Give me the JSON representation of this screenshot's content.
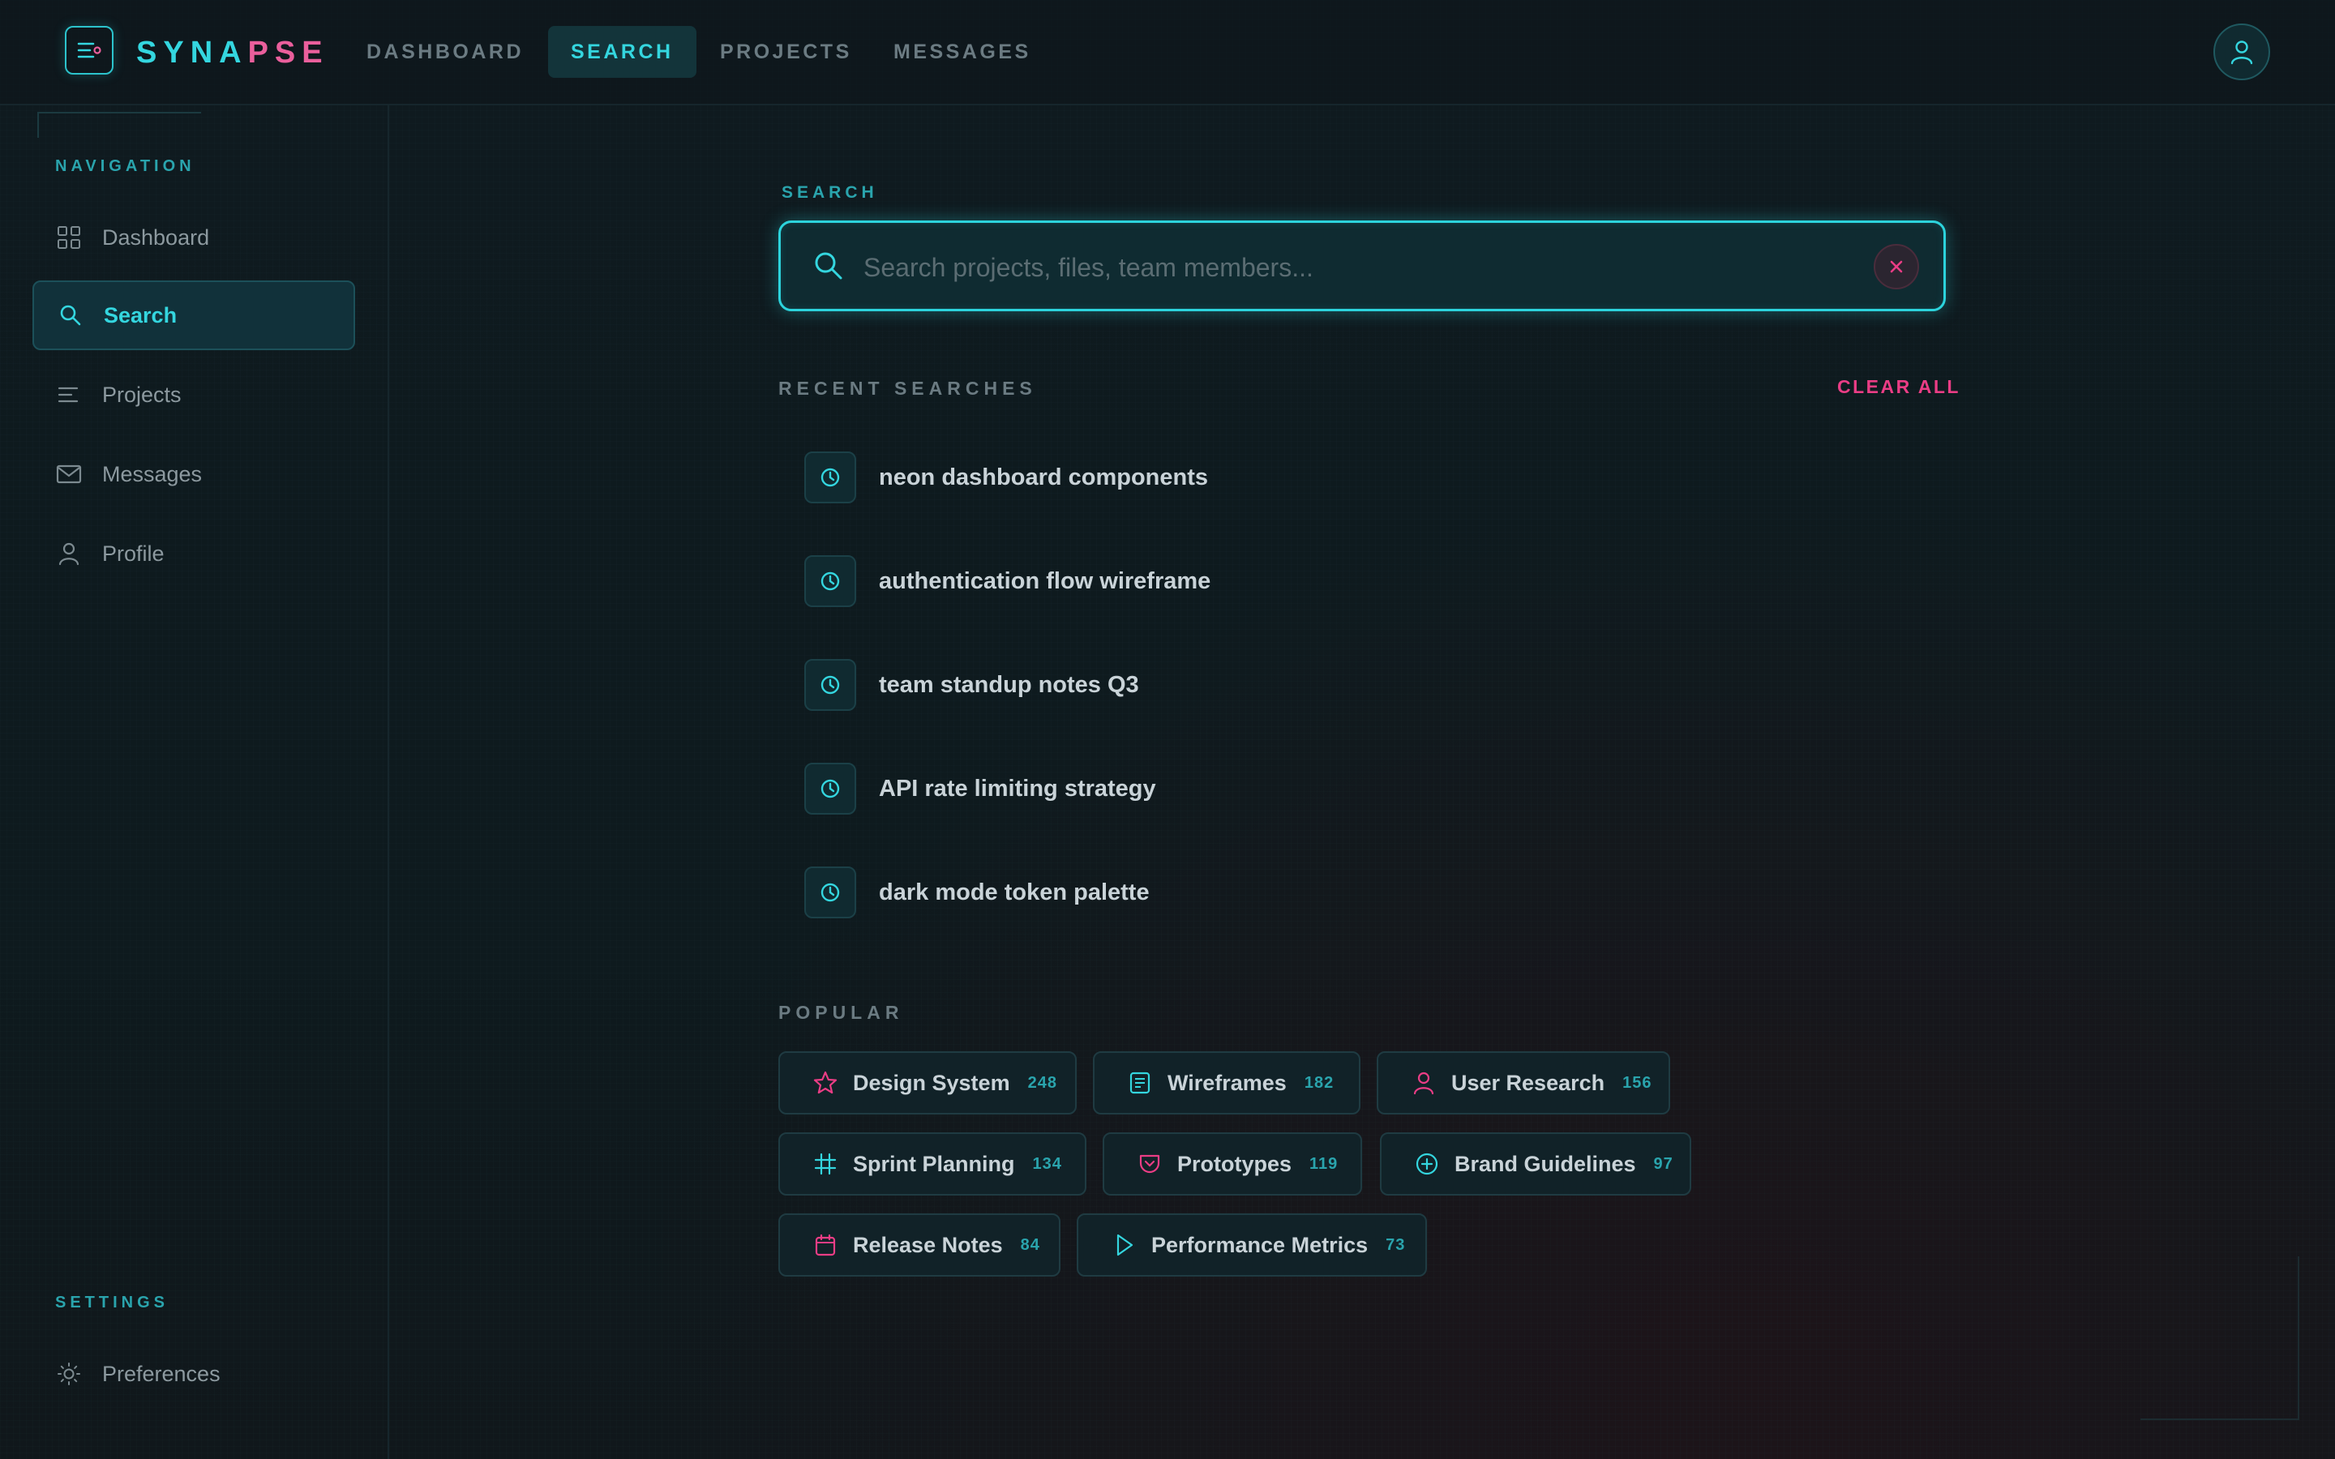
{
  "brand": {
    "part1": "SYNA",
    "part2": "PSE"
  },
  "topnav": {
    "tabs": [
      {
        "label": "DASHBOARD"
      },
      {
        "label": "SEARCH"
      },
      {
        "label": "PROJECTS"
      },
      {
        "label": "MESSAGES"
      }
    ],
    "active_tab": "SEARCH"
  },
  "sidebar": {
    "nav_label": "NAVIGATION",
    "items": [
      {
        "label": "Dashboard",
        "icon": "grid-icon"
      },
      {
        "label": "Search",
        "icon": "search-icon"
      },
      {
        "label": "Projects",
        "icon": "lines-icon"
      },
      {
        "label": "Messages",
        "icon": "mail-icon"
      },
      {
        "label": "Profile",
        "icon": "user-icon"
      }
    ],
    "active_item": "Search",
    "settings_label": "SETTINGS",
    "settings_items": [
      {
        "label": "Preferences",
        "icon": "sun-icon"
      }
    ]
  },
  "search": {
    "label": "SEARCH",
    "placeholder": "Search projects, files, team members...",
    "value": ""
  },
  "recent": {
    "label": "RECENT SEARCHES",
    "clear_label": "CLEAR ALL",
    "items": [
      "neon dashboard components",
      "authentication flow wireframe",
      "team standup notes Q3",
      "API rate limiting strategy",
      "dark mode token palette"
    ]
  },
  "popular": {
    "label": "POPULAR",
    "tags": [
      {
        "label": "Design System",
        "count": "248",
        "icon": "star-icon",
        "color": "#ea3d85"
      },
      {
        "label": "Wireframes",
        "count": "182",
        "icon": "document-icon",
        "color": "#34d6df"
      },
      {
        "label": "User Research",
        "count": "156",
        "icon": "user-icon",
        "color": "#ea3d85"
      },
      {
        "label": "Sprint Planning",
        "count": "134",
        "icon": "hash-icon",
        "color": "#34d6df"
      },
      {
        "label": "Prototypes",
        "count": "119",
        "icon": "pocket-icon",
        "color": "#ea3d85"
      },
      {
        "label": "Brand Guidelines",
        "count": "97",
        "icon": "plus-circle-icon",
        "color": "#34d6df"
      },
      {
        "label": "Release Notes",
        "count": "84",
        "icon": "calendar-icon",
        "color": "#ea3d85"
      },
      {
        "label": "Performance Metrics",
        "count": "73",
        "icon": "play-icon",
        "color": "#34d6df"
      }
    ]
  },
  "colors": {
    "accent_cyan": "#34d6df",
    "accent_pink": "#ea3d85",
    "background": "#0f1a1f"
  }
}
